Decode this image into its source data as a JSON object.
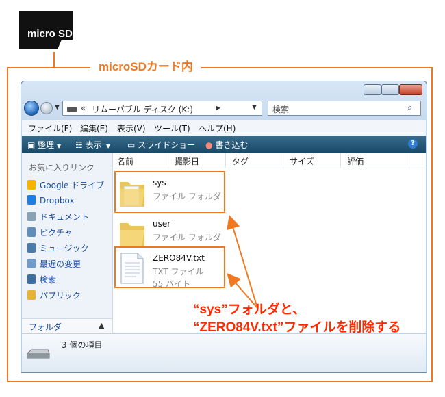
{
  "sd_card": {
    "label": "micro SD"
  },
  "frame_title": "microSDカード内",
  "window": {
    "address": {
      "history_chevron": "«",
      "label": "リムーバブル ディスク (K:)",
      "separator": "▸"
    },
    "search_placeholder": "検索",
    "menu": [
      "ファイル(F)",
      "編集(E)",
      "表示(V)",
      "ツール(T)",
      "ヘルプ(H)"
    ],
    "toolbar": {
      "organize": "整理",
      "views": "表示",
      "slideshow": "スライドショー",
      "burn": "書き込む"
    },
    "nav": {
      "favorites_title": "お気に入りリンク",
      "items": [
        "Google ドライブ",
        "Dropbox",
        "ドキュメント",
        "ピクチャ",
        "ミュージック",
        "最近の変更",
        "検索",
        "パブリック"
      ],
      "folders_label": "フォルダ"
    },
    "columns": [
      "名前",
      "撮影日",
      "タグ",
      "サイズ",
      "評価"
    ],
    "files": [
      {
        "name": "sys",
        "type": "ファイル フォルダ"
      },
      {
        "name": "user",
        "type": "ファイル フォルダ"
      },
      {
        "name": "ZERO84V.txt",
        "type": "TXT ファイル",
        "size": "55 バイト"
      }
    ],
    "status": {
      "item_count": "3 個の項目"
    }
  },
  "annotation": {
    "line1": "“sys”フォルダと、",
    "line2": "“ZERO84V.txt”ファイルを削除する"
  },
  "colors": {
    "highlight": "#f07820",
    "annotation": "#ff2a00",
    "toolbar": "#1f5070"
  }
}
